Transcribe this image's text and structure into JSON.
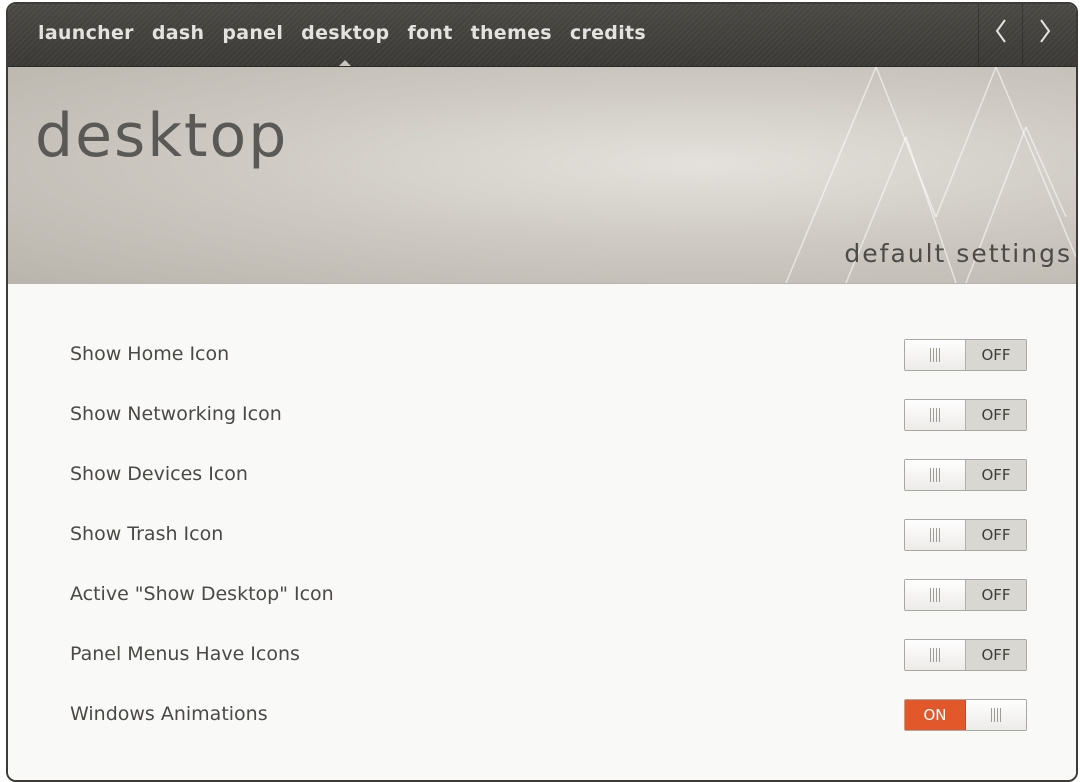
{
  "nav": {
    "items": [
      {
        "label": "launcher"
      },
      {
        "label": "dash"
      },
      {
        "label": "panel"
      },
      {
        "label": "desktop"
      },
      {
        "label": "font"
      },
      {
        "label": "themes"
      },
      {
        "label": "credits"
      }
    ],
    "active": "desktop",
    "prev_icon": "chevron-left-icon",
    "next_icon": "chevron-right-icon"
  },
  "header": {
    "title": "desktop",
    "subtitle": "default settings"
  },
  "settings": [
    {
      "label": "Show Home Icon",
      "state": "OFF"
    },
    {
      "label": "Show Networking Icon",
      "state": "OFF"
    },
    {
      "label": "Show Devices Icon",
      "state": "OFF"
    },
    {
      "label": "Show Trash Icon",
      "state": "OFF"
    },
    {
      "label": "Active \"Show Desktop\" Icon",
      "state": "OFF"
    },
    {
      "label": "Panel Menus Have Icons",
      "state": "OFF"
    },
    {
      "label": "Windows Animations",
      "state": "ON"
    }
  ],
  "colors": {
    "accent_on": "#e2582a",
    "nav_background": "#3f3e3a"
  }
}
